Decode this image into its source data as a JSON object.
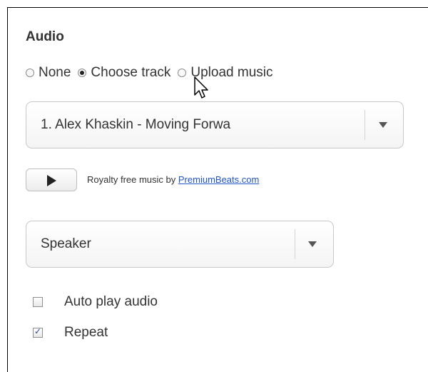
{
  "audio": {
    "title": "Audio",
    "options": [
      {
        "label": "None",
        "selected": false
      },
      {
        "label": "Choose track",
        "selected": true
      },
      {
        "label": "Upload music",
        "selected": false
      }
    ],
    "track_select": {
      "value": "1. Alex Khaskin - Moving Forwa",
      "icon": "chevron-down-icon"
    },
    "play_button": {
      "icon": "play-icon"
    },
    "credit": {
      "text": "Royalty free music by",
      "link": "PremiumBeats.com",
      "link_color": "#1f55c5"
    },
    "speaker_select": {
      "value": "Speaker",
      "icon": "chevron-down-icon"
    },
    "checkboxes": {
      "autoplay": {
        "label": "Auto play audio",
        "checked": false
      },
      "repeat": {
        "label": "Repeat",
        "checked": true
      }
    }
  },
  "cursor": {
    "icon": "mouse-pointer-icon"
  }
}
